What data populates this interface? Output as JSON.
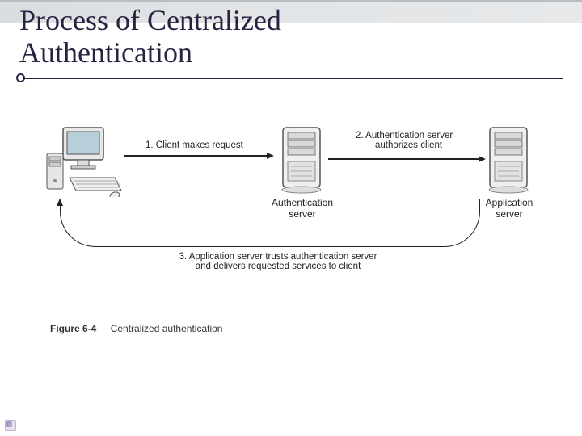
{
  "title_line1": "Process of Centralized",
  "title_line2": "Authentication",
  "steps": {
    "s1": "1. Client makes request",
    "s2_l1": "2. Authentication server",
    "s2_l2": "authorizes client",
    "s3_l1": "3. Application server trusts authentication server",
    "s3_l2": "and delivers requested services to client"
  },
  "nodes": {
    "auth_l1": "Authentication",
    "auth_l2": "server",
    "app_l1": "Application",
    "app_l2": "server"
  },
  "figure": {
    "num": "Figure 6-4",
    "caption": "Centralized authentication"
  }
}
